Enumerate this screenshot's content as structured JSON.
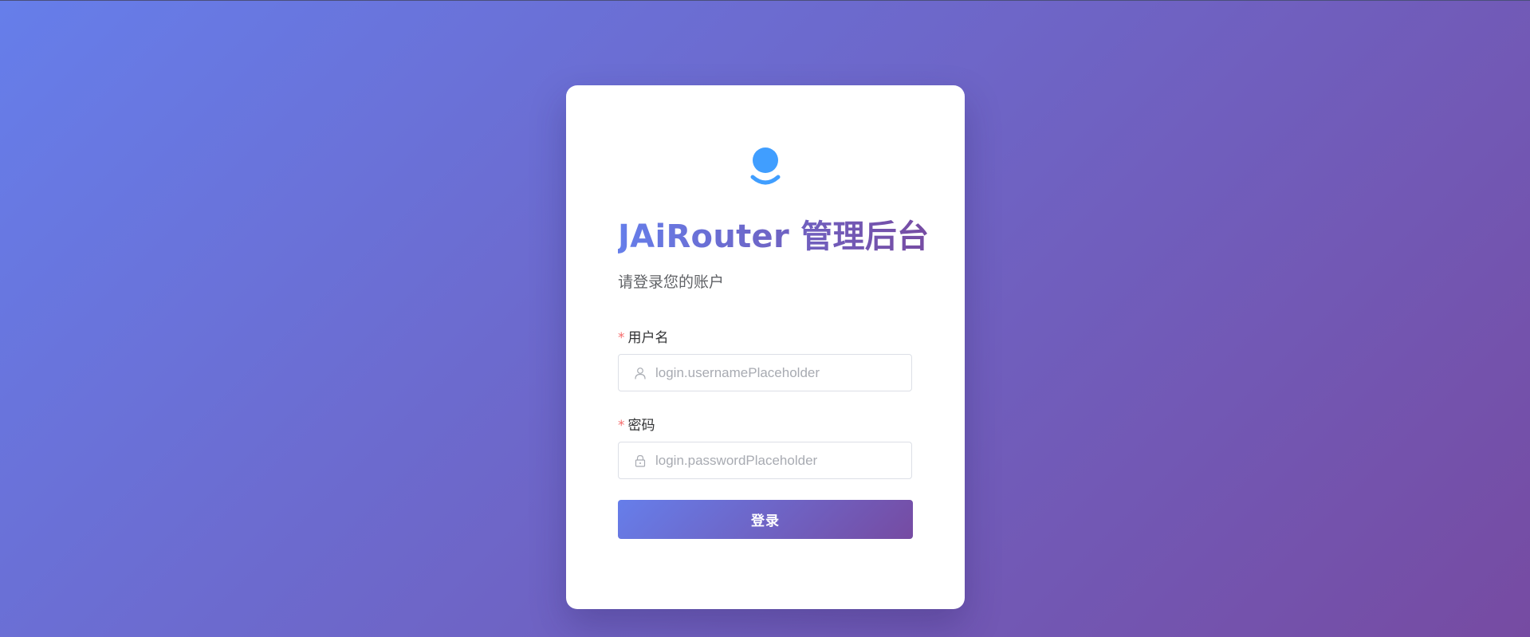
{
  "colors": {
    "gradient_start": "#667eea",
    "gradient_end": "#764ba2",
    "logo_blue": "#409eff",
    "required_mark": "#f56c6c"
  },
  "header": {
    "logo_icon": "user-avatar-icon",
    "title": "JAiRouter 管理后台",
    "subtitle": "请登录您的账户"
  },
  "form": {
    "username": {
      "required_mark": "*",
      "label": "用户名",
      "icon": "user-icon",
      "value": "",
      "placeholder": "login.usernamePlaceholder"
    },
    "password": {
      "required_mark": "*",
      "label": "密码",
      "icon": "lock-icon",
      "value": "",
      "placeholder": "login.passwordPlaceholder"
    },
    "submit_label": "登录"
  }
}
